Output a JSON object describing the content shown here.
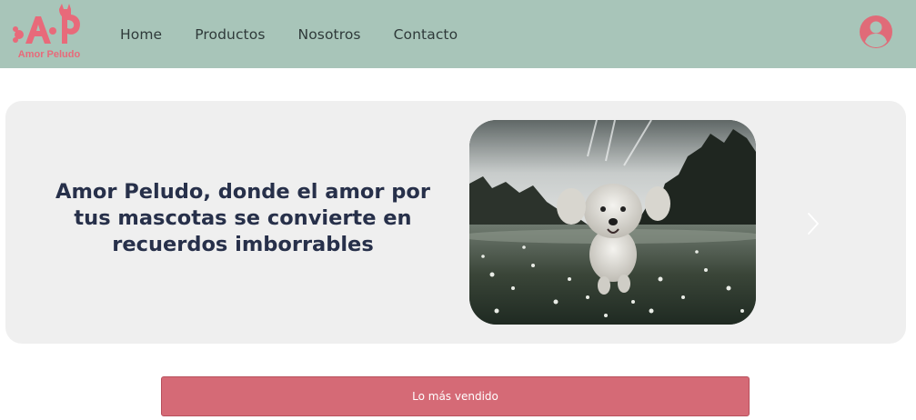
{
  "brand": {
    "name": "Amor Peludo",
    "color": "#e86a7a"
  },
  "nav": {
    "links": [
      "Home",
      "Productos",
      "Nosotros",
      "Contacto"
    ],
    "background": "#a8c5b9"
  },
  "user": {
    "icon": "user-circle-icon"
  },
  "hero": {
    "headline": "Amor Peludo, donde el amor por tus mascotas se convierte en recuerdos imborrables",
    "image": "dog-running-photo",
    "next_icon": "chevron-right-icon"
  },
  "cta": {
    "label": "Lo más vendido",
    "color": "#d56a76"
  }
}
